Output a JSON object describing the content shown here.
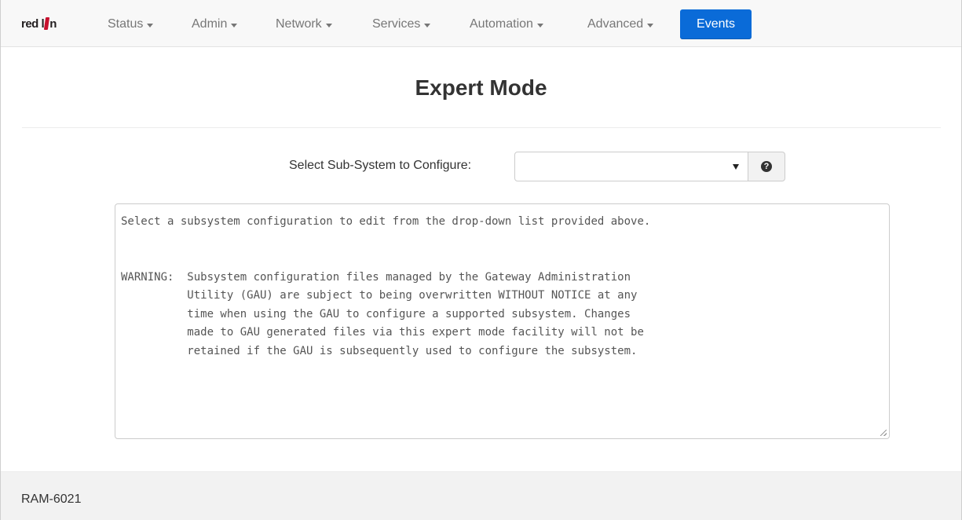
{
  "brand": {
    "logo_text_left": "red l",
    "logo_text_right": "n"
  },
  "nav": {
    "items": [
      {
        "label": "Status"
      },
      {
        "label": "Admin"
      },
      {
        "label": "Network"
      },
      {
        "label": "Services"
      },
      {
        "label": "Automation"
      },
      {
        "label": "Advanced"
      }
    ],
    "active": {
      "label": "Events"
    }
  },
  "colors": {
    "accent": "#0a6bd8",
    "brand_red": "#c8102e"
  },
  "main": {
    "title": "Expert Mode",
    "select_label": "Select Sub-System to Configure:",
    "select_value": "",
    "help_icon": "question-circle-icon",
    "editor_text": "Select a subsystem configuration to edit from the drop-down list provided above.\n\n\nWARNING:  Subsystem configuration files managed by the Gateway Administration\n          Utility (GAU) are subject to being overwritten WITHOUT NOTICE at any\n          time when using the GAU to configure a supported subsystem. Changes\n          made to GAU generated files via this expert mode facility will not be\n          retained if the GAU is subsequently used to configure the subsystem."
  },
  "footer": {
    "text": "RAM-6021"
  }
}
